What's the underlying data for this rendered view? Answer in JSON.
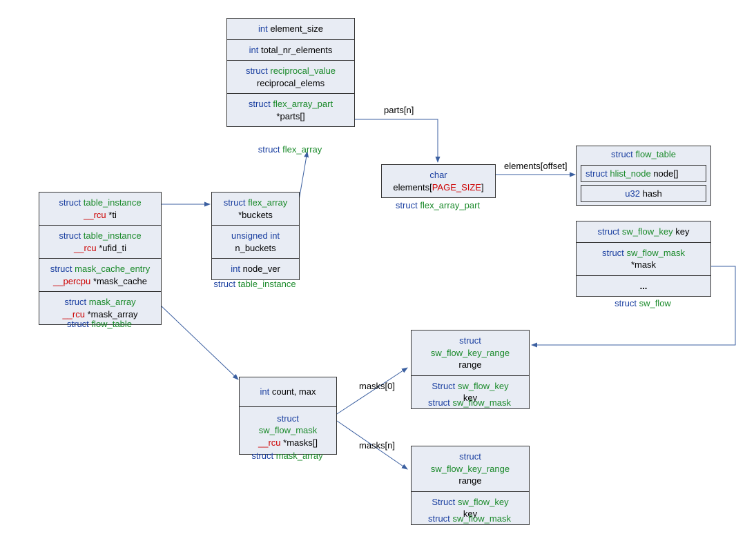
{
  "keywords": {
    "struct": "struct",
    "int": "int",
    "char": "char",
    "unsigned_int": "unsigned int",
    "Struct": "Struct",
    "u32": "u32"
  },
  "attrs": {
    "rcu": "__rcu",
    "percpu": "__percpu"
  },
  "flex_array": {
    "caption": "struct flex_array",
    "row1": "element_size",
    "row2": "total_nr_elements",
    "row3_type": "reciprocal_value",
    "row3_name": "reciprocal_elems",
    "row4_type": "flex_array_part",
    "row4_name": "*parts[]",
    "label_parts_n": "parts[n]"
  },
  "flex_array_part": {
    "caption": "struct flex_array_part",
    "elements": "elements[",
    "page_size": "PAGE_SIZE",
    "close": "]",
    "label_elem_offset": "elements[offset]"
  },
  "flow_table": {
    "caption": "struct flow_table",
    "r1_type": "table_instance",
    "r1_name": "*ti",
    "r2_type": "table_instance",
    "r2_name": "*ufid_ti",
    "r3_type": "mask_cache_entry",
    "r3_name": "*mask_cache",
    "r4_type": "mask_array",
    "r4_name": "*mask_array"
  },
  "table_instance": {
    "caption": "struct  table_instance",
    "r1_type": "flex_array",
    "r1_name": "*buckets",
    "r2_name": "n_buckets",
    "r3_name": "node_ver"
  },
  "sw_flow_top": {
    "caption_top": "struct flow_table",
    "inner1_type": "hlist_node",
    "inner1_name": "node[]",
    "inner2": "hash"
  },
  "sw_flow": {
    "caption": "struct  sw_flow",
    "r_key_type": "sw_flow_key",
    "r_key_name": "key",
    "r_mask_type": "sw_flow_mask",
    "r_mask_name": "*mask",
    "ellipsis": "..."
  },
  "mask_array": {
    "caption": "struct mask_array",
    "r1": "count, max",
    "r2_type": "sw_flow_mask",
    "r2_name": "*masks[]",
    "label_masks0": "masks[0]",
    "label_masksn": "masks[n]"
  },
  "sw_flow_mask": {
    "caption": "struct sw_flow_mask",
    "r1_type": "sw_flow_key_range",
    "r1_name": "range",
    "r2_type": "sw_flow_key",
    "r2_name": "key"
  }
}
